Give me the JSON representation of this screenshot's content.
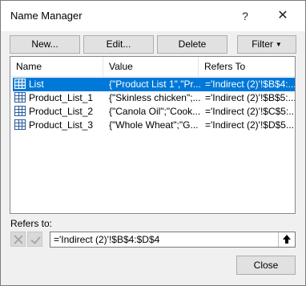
{
  "window": {
    "title": "Name Manager",
    "help_glyph": "?",
    "close_glyph": "✕"
  },
  "toolbar": {
    "new_label": "New...",
    "edit_label": "Edit...",
    "delete_label": "Delete",
    "filter_label": "Filter"
  },
  "table": {
    "columns": [
      "Name",
      "Value",
      "Refers To"
    ],
    "rows": [
      {
        "name": "List",
        "value": "{\"Product List 1\",\"Pr...",
        "refers_to": "='Indirect (2)'!$B$4:...",
        "selected": true
      },
      {
        "name": "Product_List_1",
        "value": "{\"Skinless chicken\";...",
        "refers_to": "='Indirect (2)'!$B$5:...",
        "selected": false
      },
      {
        "name": "Product_List_2",
        "value": "{\"Canola Oil\";\"Cook...",
        "refers_to": "='Indirect (2)'!$C$5:...",
        "selected": false
      },
      {
        "name": "Product_List_3",
        "value": "{\"Whole Wheat\";\"G...",
        "refers_to": "='Indirect (2)'!$D$5...",
        "selected": false
      }
    ]
  },
  "refers": {
    "label": "Refers to:",
    "value": "='Indirect (2)'!$B$4:$D$4"
  },
  "footer": {
    "close_label": "Close"
  },
  "colors": {
    "selection": "#0078d7",
    "dialog_bg": "#f0f0f0"
  }
}
